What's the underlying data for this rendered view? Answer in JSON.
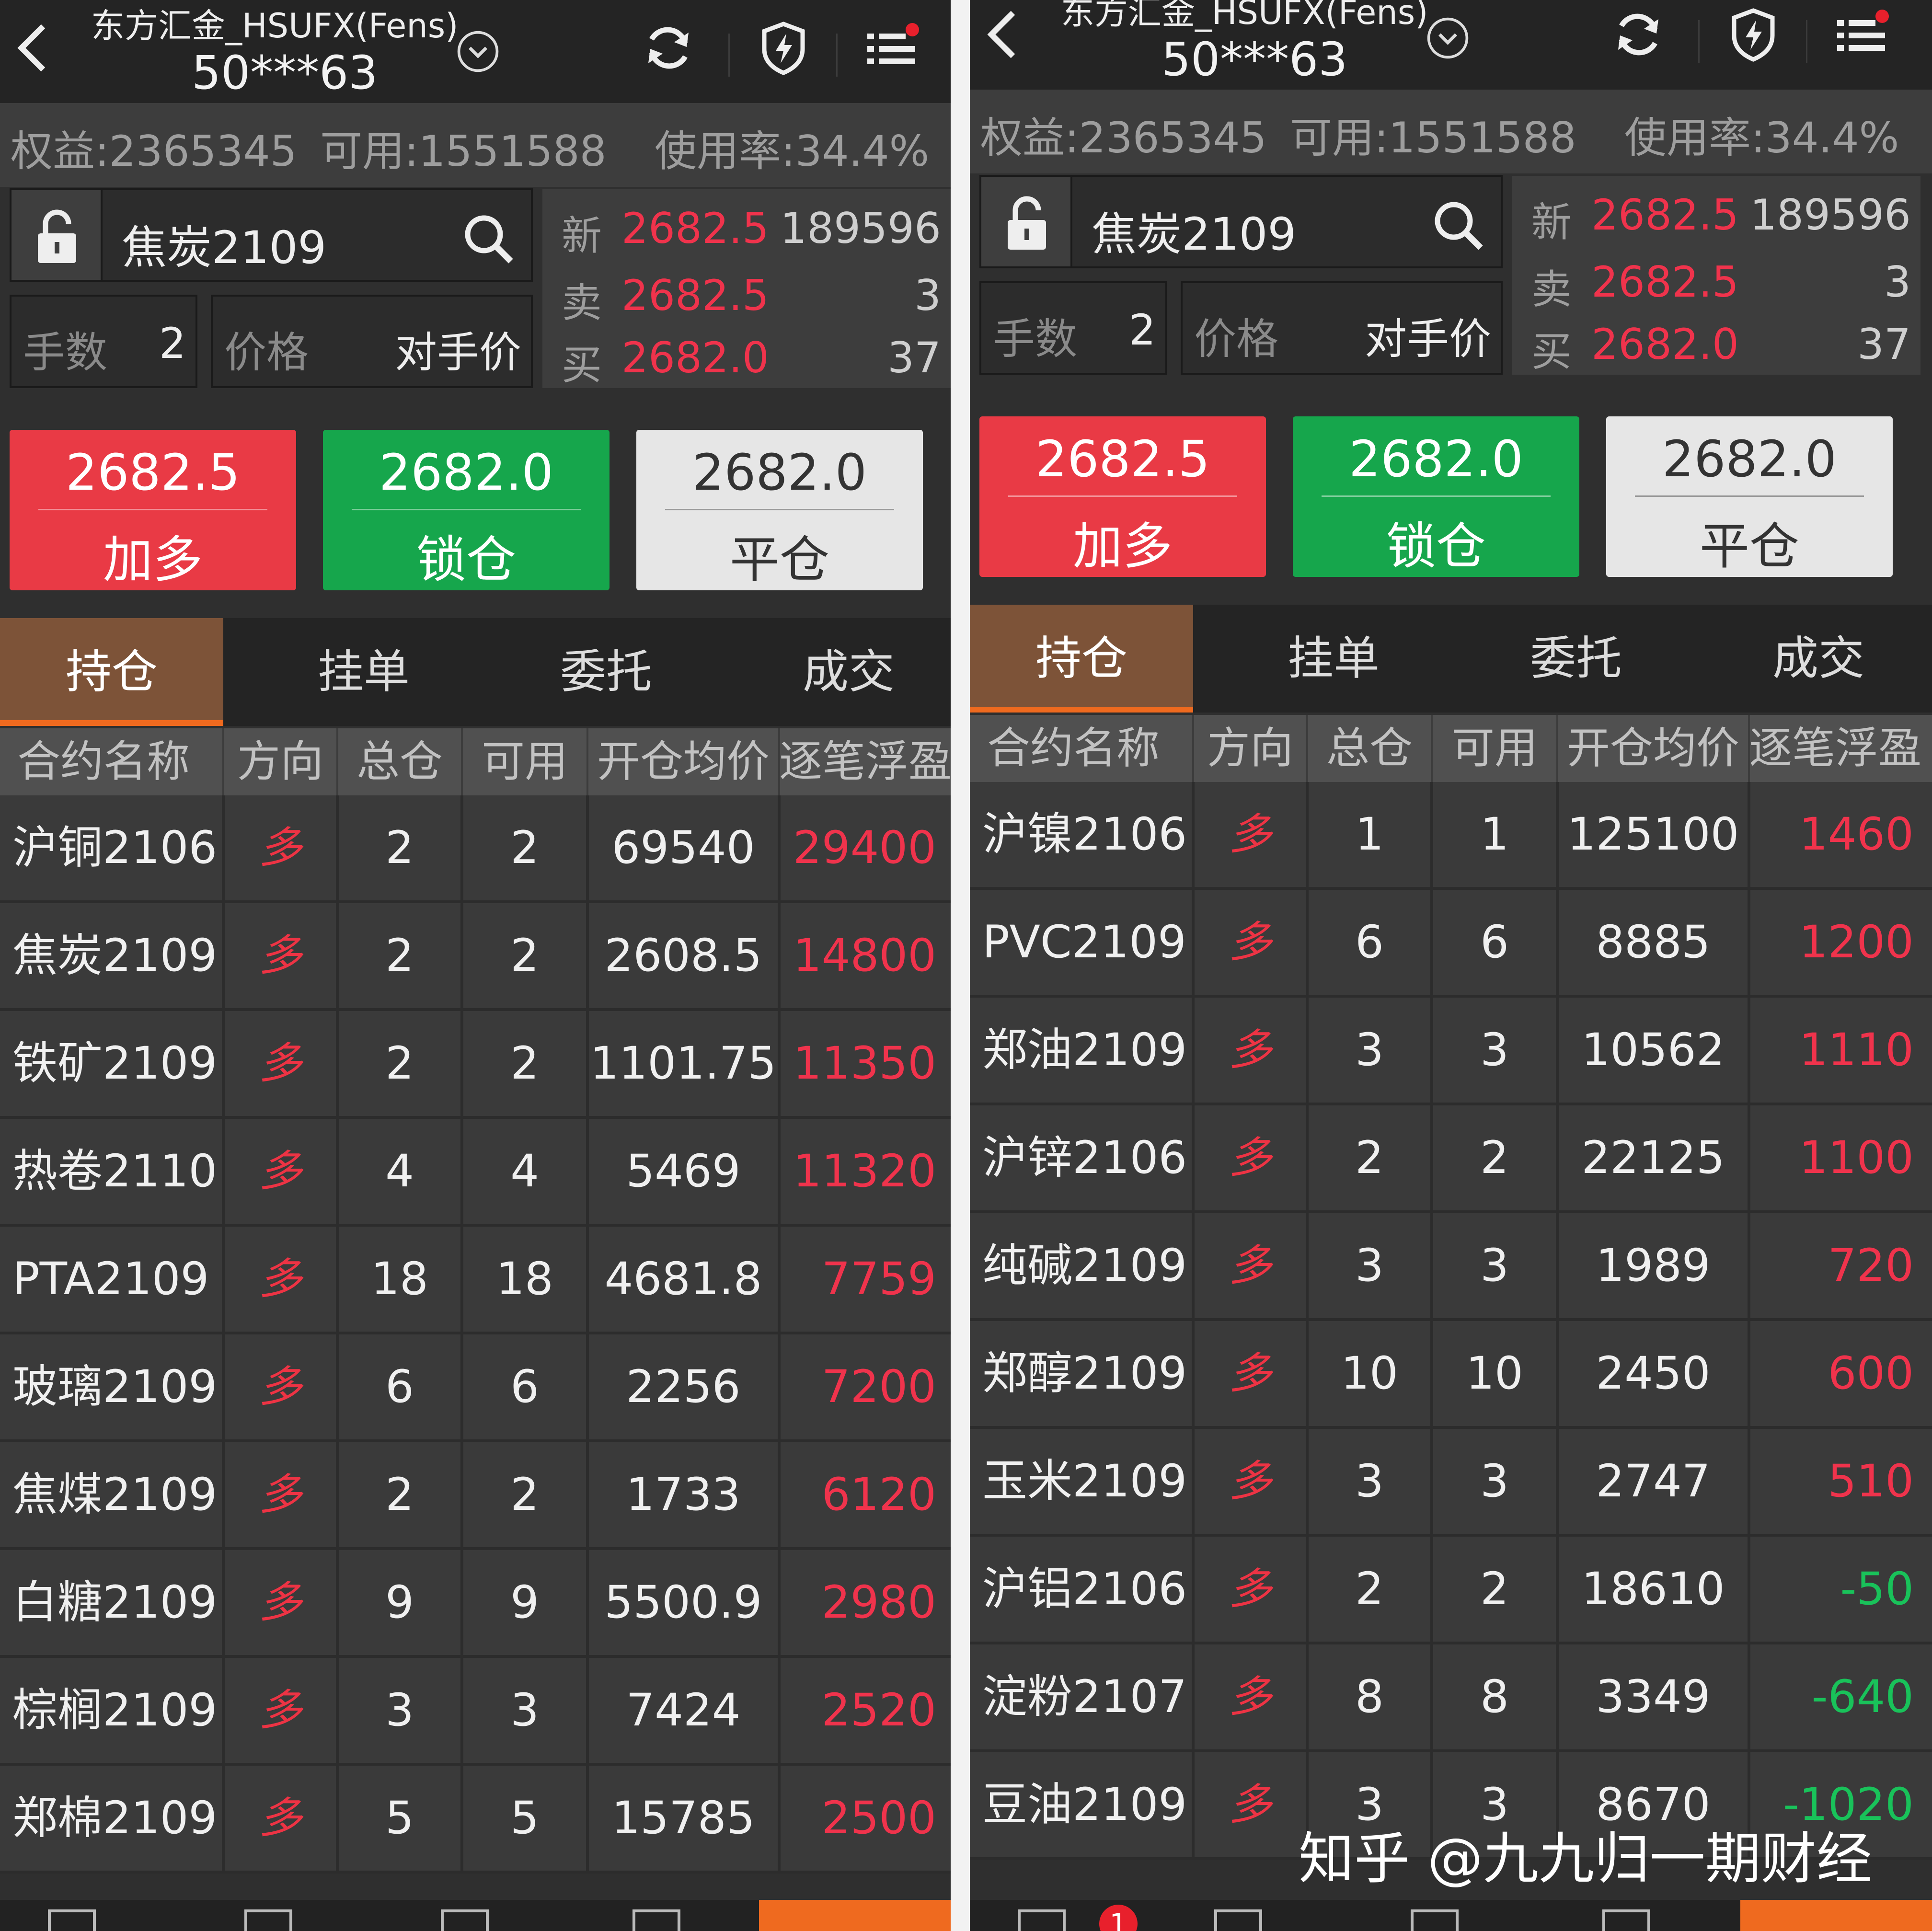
{
  "left": {
    "account_name": "东方汇金_HSUFX(Fens)",
    "account_no": "50***63",
    "stats": {
      "equity": "权益:2365345",
      "available": "可用:1551588",
      "usage": "使用率:34.4%"
    },
    "symbol": "焦炭2109",
    "qty_label": "手数",
    "qty_value": "2",
    "price_label": "价格",
    "price_value": "对手价",
    "quote": {
      "last_label": "新",
      "last_price": "2682.5",
      "last_vol": "189596",
      "ask_label": "卖",
      "ask_price": "2682.5",
      "ask_vol": "3",
      "bid_label": "买",
      "bid_price": "2682.0",
      "bid_vol": "37"
    },
    "buttons": [
      {
        "price": "2682.5",
        "label": "加多"
      },
      {
        "price": "2682.0",
        "label": "锁仓"
      },
      {
        "price": "2682.0",
        "label": "平仓"
      }
    ],
    "tabs": [
      "持仓",
      "挂单",
      "委托",
      "成交"
    ],
    "columns": [
      "合约名称",
      "方向",
      "总仓",
      "可用",
      "开仓均价",
      "逐笔浮盈"
    ],
    "rows": [
      {
        "name": "沪铜2106",
        "dir": "多",
        "total": "2",
        "avail": "2",
        "avg": "69540",
        "pnl": "29400"
      },
      {
        "name": "焦炭2109",
        "dir": "多",
        "total": "2",
        "avail": "2",
        "avg": "2608.5",
        "pnl": "14800"
      },
      {
        "name": "铁矿2109",
        "dir": "多",
        "total": "2",
        "avail": "2",
        "avg": "1101.75",
        "pnl": "11350"
      },
      {
        "name": "热卷2110",
        "dir": "多",
        "total": "4",
        "avail": "4",
        "avg": "5469",
        "pnl": "11320"
      },
      {
        "name": "PTA2109",
        "dir": "多",
        "total": "18",
        "avail": "18",
        "avg": "4681.8",
        "pnl": "7759"
      },
      {
        "name": "玻璃2109",
        "dir": "多",
        "total": "6",
        "avail": "6",
        "avg": "2256",
        "pnl": "7200"
      },
      {
        "name": "焦煤2109",
        "dir": "多",
        "total": "2",
        "avail": "2",
        "avg": "1733",
        "pnl": "6120"
      },
      {
        "name": "白糖2109",
        "dir": "多",
        "total": "9",
        "avail": "9",
        "avg": "5500.9",
        "pnl": "2980"
      },
      {
        "name": "棕榈2109",
        "dir": "多",
        "total": "3",
        "avail": "3",
        "avg": "7424",
        "pnl": "2520"
      },
      {
        "name": "郑棉2109",
        "dir": "多",
        "total": "5",
        "avail": "5",
        "avg": "15785",
        "pnl": "2500"
      }
    ],
    "nav_badge": ""
  },
  "right": {
    "account_name": "东方汇金_HSUFX(Fens)",
    "account_no": "50***63",
    "stats": {
      "equity": "权益:2365345",
      "available": "可用:1551588",
      "usage": "使用率:34.4%"
    },
    "symbol": "焦炭2109",
    "qty_label": "手数",
    "qty_value": "2",
    "price_label": "价格",
    "price_value": "对手价",
    "quote": {
      "last_label": "新",
      "last_price": "2682.5",
      "last_vol": "189596",
      "ask_label": "卖",
      "ask_price": "2682.5",
      "ask_vol": "3",
      "bid_label": "买",
      "bid_price": "2682.0",
      "bid_vol": "37"
    },
    "buttons": [
      {
        "price": "2682.5",
        "label": "加多"
      },
      {
        "price": "2682.0",
        "label": "锁仓"
      },
      {
        "price": "2682.0",
        "label": "平仓"
      }
    ],
    "tabs": [
      "持仓",
      "挂单",
      "委托",
      "成交"
    ],
    "columns": [
      "合约名称",
      "方向",
      "总仓",
      "可用",
      "开仓均价",
      "逐笔浮盈"
    ],
    "rows": [
      {
        "name": "沪镍2106",
        "dir": "多",
        "total": "1",
        "avail": "1",
        "avg": "125100",
        "pnl": "1460"
      },
      {
        "name": "PVC2109",
        "dir": "多",
        "total": "6",
        "avail": "6",
        "avg": "8885",
        "pnl": "1200"
      },
      {
        "name": "郑油2109",
        "dir": "多",
        "total": "3",
        "avail": "3",
        "avg": "10562",
        "pnl": "1110"
      },
      {
        "name": "沪锌2106",
        "dir": "多",
        "total": "2",
        "avail": "2",
        "avg": "22125",
        "pnl": "1100"
      },
      {
        "name": "纯碱2109",
        "dir": "多",
        "total": "3",
        "avail": "3",
        "avg": "1989",
        "pnl": "720"
      },
      {
        "name": "郑醇2109",
        "dir": "多",
        "total": "10",
        "avail": "10",
        "avg": "2450",
        "pnl": "600"
      },
      {
        "name": "玉米2109",
        "dir": "多",
        "total": "3",
        "avail": "3",
        "avg": "2747",
        "pnl": "510"
      },
      {
        "name": "沪铝2106",
        "dir": "多",
        "total": "2",
        "avail": "2",
        "avg": "18610",
        "pnl": "-50"
      },
      {
        "name": "淀粉2107",
        "dir": "多",
        "total": "8",
        "avail": "8",
        "avg": "3349",
        "pnl": "-640"
      },
      {
        "name": "豆油2109",
        "dir": "多",
        "total": "3",
        "avail": "3",
        "avg": "8670",
        "pnl": "-1020"
      }
    ],
    "nav_badge": "1"
  },
  "watermark": "知乎 @九九归一期财经",
  "colors": {
    "profit": "#f0334c",
    "loss": "#19c25a",
    "buy": "#e93a45",
    "lock": "#16a64c",
    "accent": "#ef6a1f",
    "active_tab": "#7d5338"
  }
}
